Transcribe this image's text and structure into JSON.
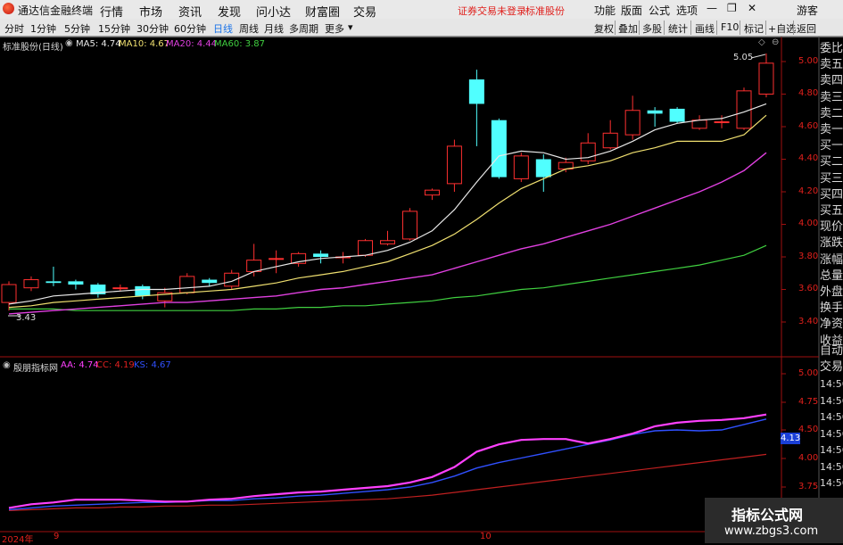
{
  "titlebar": {
    "app_name": "通达信金融终端",
    "menus": [
      "行情",
      "市场",
      "资讯",
      "发现",
      "问小达",
      "财富圈",
      "交易"
    ],
    "warning": "证券交易未登录",
    "stock_name": "标准股份",
    "right_menus": [
      "功能",
      "版面",
      "公式",
      "选项"
    ],
    "user": "游客"
  },
  "toolbar": {
    "timeframes": [
      "分时",
      "1分钟",
      "5分钟",
      "15分钟",
      "30分钟",
      "60分钟",
      "日线",
      "周线",
      "月线",
      "多周期",
      "更多"
    ],
    "active_timeframe": "日线",
    "right_buttons": [
      "复权",
      "叠加",
      "多股",
      "统计",
      "画线",
      "F10",
      "标记",
      "+自选",
      "返回"
    ]
  },
  "main_chart": {
    "stock_label": "标准股份(日线)",
    "ma": [
      {
        "label": "MA5: 4.74",
        "color": "#e8e8e8"
      },
      {
        "label": "MA10: 4.67",
        "color": "#f0e070"
      },
      {
        "label": "MA20: 4.44",
        "color": "#e040e0"
      },
      {
        "label": "MA60: 3.87",
        "color": "#40d040"
      }
    ],
    "high_label": "5.05",
    "low_label": "3.43",
    "y_ticks": [
      "5.00",
      "4.80",
      "4.60",
      "4.40",
      "4.20",
      "4.00",
      "3.80",
      "3.60",
      "3.40"
    ],
    "candles": [
      [
        3.52,
        3.63,
        3.65,
        3.47
      ],
      [
        3.61,
        3.66,
        3.68,
        3.59
      ],
      [
        3.65,
        3.64,
        3.74,
        3.62
      ],
      [
        3.65,
        3.63,
        3.66,
        3.6
      ],
      [
        3.63,
        3.57,
        3.64,
        3.55
      ],
      [
        3.61,
        3.61,
        3.63,
        3.59
      ],
      [
        3.62,
        3.56,
        3.63,
        3.54
      ],
      [
        3.53,
        3.58,
        3.61,
        3.49
      ],
      [
        3.58,
        3.68,
        3.7,
        3.57
      ],
      [
        3.66,
        3.64,
        3.67,
        3.62
      ],
      [
        3.62,
        3.7,
        3.72,
        3.6
      ],
      [
        3.71,
        3.78,
        3.88,
        3.68
      ],
      [
        3.79,
        3.79,
        3.84,
        3.7
      ],
      [
        3.76,
        3.82,
        3.83,
        3.74
      ],
      [
        3.82,
        3.8,
        3.84,
        3.76
      ],
      [
        3.8,
        3.8,
        3.83,
        3.76
      ],
      [
        3.81,
        3.9,
        3.91,
        3.8
      ],
      [
        3.88,
        3.9,
        3.96,
        3.87
      ],
      [
        3.91,
        4.08,
        4.1,
        3.9
      ],
      [
        4.18,
        4.21,
        4.22,
        4.15
      ],
      [
        4.25,
        4.48,
        4.52,
        4.2
      ],
      [
        4.89,
        4.74,
        4.95,
        4.48
      ],
      [
        4.64,
        4.29,
        4.65,
        4.28
      ],
      [
        4.28,
        4.42,
        4.44,
        4.26
      ],
      [
        4.4,
        4.29,
        4.43,
        4.2
      ],
      [
        4.34,
        4.38,
        4.41,
        4.32
      ],
      [
        4.39,
        4.5,
        4.56,
        4.37
      ],
      [
        4.47,
        4.56,
        4.64,
        4.46
      ],
      [
        4.55,
        4.7,
        4.79,
        4.52
      ],
      [
        4.7,
        4.68,
        4.72,
        4.6
      ],
      [
        4.71,
        4.63,
        4.72,
        4.62
      ],
      [
        4.59,
        4.64,
        4.67,
        4.58
      ],
      [
        4.63,
        4.63,
        4.67,
        4.59
      ],
      [
        4.59,
        4.82,
        4.84,
        4.58
      ],
      [
        4.8,
        4.99,
        5.05,
        4.78
      ]
    ],
    "ma5": [
      3.51,
      3.53,
      3.56,
      3.57,
      3.58,
      3.59,
      3.6,
      3.6,
      3.61,
      3.62,
      3.65,
      3.71,
      3.74,
      3.77,
      3.79,
      3.8,
      3.81,
      3.84,
      3.89,
      3.96,
      4.09,
      4.26,
      4.42,
      4.45,
      4.44,
      4.4,
      4.41,
      4.45,
      4.51,
      4.58,
      4.62,
      4.64,
      4.65,
      4.69,
      4.74
    ],
    "ma10": [
      3.49,
      3.5,
      3.52,
      3.53,
      3.54,
      3.55,
      3.56,
      3.57,
      3.58,
      3.59,
      3.6,
      3.62,
      3.64,
      3.67,
      3.69,
      3.71,
      3.74,
      3.77,
      3.82,
      3.87,
      3.94,
      4.03,
      4.13,
      4.22,
      4.28,
      4.34,
      4.36,
      4.39,
      4.44,
      4.47,
      4.51,
      4.51,
      4.51,
      4.55,
      4.67
    ],
    "ma20": [
      3.45,
      3.46,
      3.47,
      3.48,
      3.49,
      3.5,
      3.51,
      3.52,
      3.52,
      3.53,
      3.54,
      3.55,
      3.56,
      3.58,
      3.6,
      3.61,
      3.63,
      3.65,
      3.67,
      3.69,
      3.73,
      3.77,
      3.81,
      3.85,
      3.88,
      3.92,
      3.96,
      4.0,
      4.05,
      4.1,
      4.15,
      4.2,
      4.26,
      4.33,
      4.44
    ],
    "ma60": [
      3.48,
      3.48,
      3.48,
      3.47,
      3.47,
      3.47,
      3.47,
      3.47,
      3.47,
      3.47,
      3.47,
      3.48,
      3.48,
      3.49,
      3.49,
      3.5,
      3.5,
      3.51,
      3.52,
      3.53,
      3.55,
      3.56,
      3.58,
      3.6,
      3.61,
      3.63,
      3.65,
      3.67,
      3.69,
      3.71,
      3.73,
      3.75,
      3.78,
      3.81,
      3.87
    ]
  },
  "indicator": {
    "name": "殷朋指标网",
    "lines": [
      {
        "label": "AA: 4.74",
        "color": "#ff40ff"
      },
      {
        "label": "CC: 4.19",
        "color": "#e02020"
      },
      {
        "label": "KS: 4.67",
        "color": "#3050ff"
      }
    ],
    "y_ticks": [
      "5.00",
      "4.75",
      "4.50",
      "4.25",
      "4.00",
      "3.75"
    ],
    "current_value": "4.13",
    "aa": [
      3.52,
      3.56,
      3.58,
      3.61,
      3.61,
      3.61,
      3.6,
      3.59,
      3.59,
      3.61,
      3.62,
      3.65,
      3.67,
      3.69,
      3.7,
      3.72,
      3.74,
      3.76,
      3.8,
      3.86,
      3.97,
      4.14,
      4.22,
      4.27,
      4.28,
      4.28,
      4.23,
      4.28,
      4.34,
      4.42,
      4.46,
      4.48,
      4.49,
      4.51,
      4.55
    ],
    "ks": [
      3.5,
      3.52,
      3.54,
      3.55,
      3.56,
      3.57,
      3.58,
      3.58,
      3.59,
      3.6,
      3.6,
      3.62,
      3.63,
      3.65,
      3.66,
      3.68,
      3.7,
      3.72,
      3.75,
      3.8,
      3.87,
      3.96,
      4.02,
      4.07,
      4.12,
      4.17,
      4.22,
      4.27,
      4.33,
      4.37,
      4.38,
      4.37,
      4.38,
      4.44,
      4.5
    ],
    "cc": [
      3.49,
      3.5,
      3.51,
      3.52,
      3.52,
      3.53,
      3.53,
      3.54,
      3.54,
      3.55,
      3.55,
      3.56,
      3.57,
      3.58,
      3.59,
      3.6,
      3.61,
      3.62,
      3.64,
      3.66,
      3.69,
      3.72,
      3.75,
      3.78,
      3.81,
      3.84,
      3.87,
      3.9,
      3.93,
      3.96,
      3.99,
      4.02,
      4.05,
      4.08,
      4.11
    ]
  },
  "side_labels": [
    "委比",
    "卖五",
    "卖四",
    "卖三",
    "卖二",
    "卖一",
    "买一",
    "买二",
    "买三",
    "买四",
    "买五",
    "现价",
    "涨跌",
    "涨幅",
    "总量",
    "外盘",
    "换手",
    "净资",
    "收益"
  ],
  "side_bottom": [
    "自动",
    "交易"
  ],
  "side_times": [
    "14:56",
    "14:56",
    "14:56",
    "14:56",
    "14:56",
    "14:56",
    "14:56"
  ],
  "x_labels": {
    "year": "2024年",
    "m1": "9",
    "m2": "10"
  },
  "watermark": {
    "line1": "指标公式网",
    "line2": "www.zbgs3.com"
  },
  "colors": {
    "up": "#ff3030",
    "down": "#50ffff",
    "axis": "#a01010"
  }
}
